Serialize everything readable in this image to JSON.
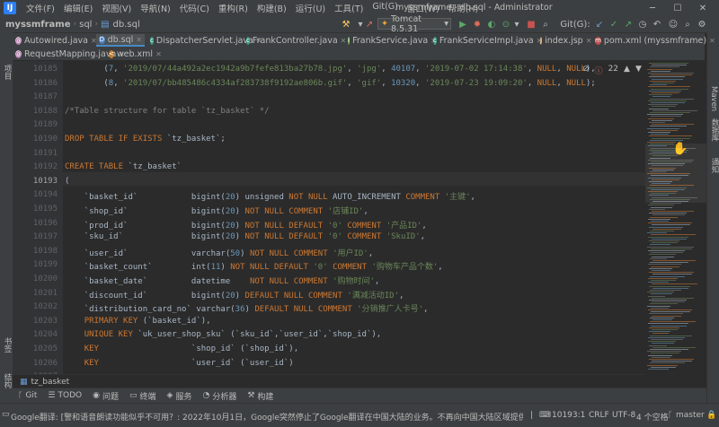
{
  "menubar": {
    "items": [
      "文件(F)",
      "编辑(E)",
      "视图(V)",
      "导航(N)",
      "代码(C)",
      "重构(R)",
      "构建(B)",
      "运行(U)",
      "工具(T)",
      "Git(G)",
      "窗口(W)",
      "帮助(H)"
    ],
    "window_title": "myssmframe - db.sql - Administrator"
  },
  "navbar": {
    "project": "myssmframe",
    "folder": "sql",
    "file": "db.sql",
    "run_config": "Tomcat 8.5.31",
    "git_label": "Git(G):"
  },
  "tabs": [
    {
      "label": "Autowired.java",
      "icon": "@",
      "color": "#b07ea9"
    },
    {
      "label": "db.sql",
      "icon": "D",
      "color": "#4b83c4",
      "active": true
    },
    {
      "label": "DispatcherServlet.java",
      "icon": "c",
      "color": "#3a9e85"
    },
    {
      "label": "FrankController.java",
      "icon": "c",
      "color": "#3a9e85"
    },
    {
      "label": "FrankService.java",
      "icon": "I",
      "color": "#6aa84f"
    },
    {
      "label": "FrankServiceImpl.java",
      "icon": "c",
      "color": "#3a9e85"
    },
    {
      "label": "index.jsp",
      "icon": "J",
      "color": "#c27c2e"
    },
    {
      "label": "pom.xml (myssmframe)",
      "icon": "m",
      "color": "#c0504d"
    },
    {
      "label": "RequestMapping.java",
      "icon": "@",
      "color": "#b07ea9"
    },
    {
      "label": "web.xml",
      "icon": "<",
      "color": "#c27c2e"
    }
  ],
  "inspection": {
    "count": "22"
  },
  "left_strip": {
    "labels": [
      "项目",
      "书签",
      "结构"
    ]
  },
  "right_strip": {
    "labels": [
      "Maven",
      "数据库",
      "通知"
    ]
  },
  "lines": [
    {
      "n": "10185",
      "html": "        (<span class=\"num\">7</span>, <span class=\"str\">'2019/07/44a492a2ec1942a9b7fefe813ba27b78.jpg'</span>, <span class=\"str\">'jpg'</span>, <span class=\"num\">40107</span>, <span class=\"str\">'2019-07-02 17:14:38'</span>, <span class=\"kw\">NULL</span>, <span class=\"kw\">NULL</span>),"
    },
    {
      "n": "10186",
      "html": "        (<span class=\"num\">8</span>, <span class=\"str\">'2019/07/bb485486c4334af283738f9192ae806b.gif'</span>, <span class=\"str\">'gif'</span>, <span class=\"num\">10320</span>, <span class=\"str\">'2019-07-23 19:09:20'</span>, <span class=\"kw\">NULL</span>, <span class=\"kw\">NULL</span>);"
    },
    {
      "n": "10187",
      "html": ""
    },
    {
      "n": "10188",
      "html": "<span class=\"cmt\">/*Table structure for table `tz_basket` */</span>"
    },
    {
      "n": "10189",
      "html": ""
    },
    {
      "n": "10190",
      "html": "<span class=\"kw\">DROP TABLE IF EXISTS</span> `tz_basket`;"
    },
    {
      "n": "10191",
      "html": ""
    },
    {
      "n": "10192",
      "html": "<span class=\"kw\">CREATE TABLE</span> `tz_basket`"
    },
    {
      "n": "10193",
      "html": "(",
      "cur": true
    },
    {
      "n": "10194",
      "html": "    `basket_id`           <span class=\"fn\">bigint</span>(<span class=\"num\">20</span>) unsigned <span class=\"kw\">NOT NULL</span> AUTO_INCREMENT <span class=\"kw\">COMMENT</span> <span class=\"str\">'主键'</span>,"
    },
    {
      "n": "10195",
      "html": "    `shop_id`             <span class=\"fn\">bigint</span>(<span class=\"num\">20</span>) <span class=\"kw\">NOT NULL</span> <span class=\"kw\">COMMENT</span> <span class=\"str\">'店铺ID'</span>,"
    },
    {
      "n": "10196",
      "html": "    `prod_id`             <span class=\"fn\">bigint</span>(<span class=\"num\">20</span>) <span class=\"kw\">NOT NULL DEFAULT</span> <span class=\"str\">'0'</span> <span class=\"kw\">COMMENT</span> <span class=\"str\">'产品ID'</span>,"
    },
    {
      "n": "10197",
      "html": "    `sku_id`              <span class=\"fn\">bigint</span>(<span class=\"num\">20</span>) <span class=\"kw\">NOT NULL DEFAULT</span> <span class=\"str\">'0'</span> <span class=\"kw\">COMMENT</span> <span class=\"str\">'SkuID'</span>,"
    },
    {
      "n": "10198",
      "html": "    `user_id`             <span class=\"fn\">varchar</span>(<span class=\"num\">50</span>) <span class=\"kw\">NOT NULL</span> <span class=\"kw\">COMMENT</span> <span class=\"str\">'用户ID'</span>,"
    },
    {
      "n": "10199",
      "html": "    `basket_count`        <span class=\"fn\">int</span>(<span class=\"num\">11</span>) <span class=\"kw\">NOT NULL DEFAULT</span> <span class=\"str\">'0'</span> <span class=\"kw\">COMMENT</span> <span class=\"str\">'购物车产品个数'</span>,"
    },
    {
      "n": "10200",
      "html": "    `basket_date`         <span class=\"fn\">datetime</span>    <span class=\"kw\">NOT NULL</span> <span class=\"kw\">COMMENT</span> <span class=\"str\">'购物时间'</span>,"
    },
    {
      "n": "10201",
      "html": "    `discount_id`         <span class=\"fn\">bigint</span>(<span class=\"num\">20</span>) <span class=\"kw\">DEFAULT NULL</span> <span class=\"kw\">COMMENT</span> <span class=\"str\">'满减活动ID'</span>,"
    },
    {
      "n": "10202",
      "html": "    `distribution_card_no` <span class=\"fn\">varchar</span>(<span class=\"num\">36</span>) <span class=\"kw\">DEFAULT NULL</span> <span class=\"kw\">COMMENT</span> <span class=\"str\">'分销推广人卡号'</span>,"
    },
    {
      "n": "10203",
      "html": "    <span class=\"kw\">PRIMARY KEY</span> (`basket_id`),"
    },
    {
      "n": "10204",
      "html": "    <span class=\"kw\">UNIQUE KEY</span> `uk_user_shop_sku` (`sku_id`,`user_id`,`shop_id`),"
    },
    {
      "n": "10205",
      "html": "    <span class=\"kw\">KEY</span>                   `shop_id` (`shop_id`),"
    },
    {
      "n": "10206",
      "html": "    <span class=\"kw\">KEY</span>                   `user_id` (`user_id`)"
    },
    {
      "n": "10207",
      "html": ") ENGINE=InnoDB <span class=\"kw\">DEFAULT</span> CHARSET=utf8 <span class=\"kw\">COMMENT</span>=<span class=\"str\">'购物车'</span>;"
    },
    {
      "n": "10208",
      "html": ""
    }
  ],
  "breadcrumb_bottom": "tz_basket",
  "tool_tabs": [
    {
      "icon": "ᚴ",
      "label": "Git"
    },
    {
      "icon": "☰",
      "label": "TODO"
    },
    {
      "icon": "◉",
      "label": "问题"
    },
    {
      "icon": "▭",
      "label": "终端"
    },
    {
      "icon": "◈",
      "label": "服务"
    },
    {
      "icon": "◔",
      "label": "分析器"
    },
    {
      "icon": "⚒",
      "label": "构建"
    }
  ],
  "status": {
    "message": "Google翻译: [警和语音朗读功能似乎不可用？: 2022年10月1日，Google突然停止了Google翻译在中国大陆的业务。不再向中国大陆区域提供翻译服务... (2 分钟之前)",
    "position": "10193:1",
    "line_sep": "CRLF",
    "encoding": "UTF-8",
    "indent": "4 个空格",
    "branch": "master"
  }
}
